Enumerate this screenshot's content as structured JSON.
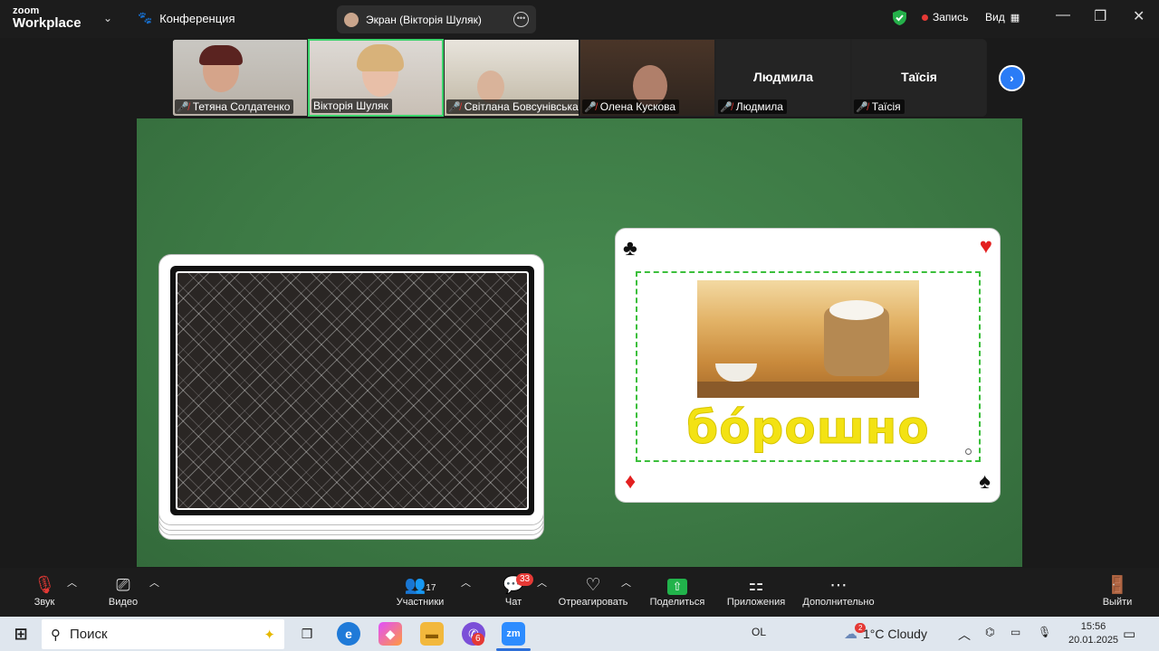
{
  "app": {
    "logo_top": "zoom",
    "logo_bottom": "Workplace",
    "meeting_label": "Конференция"
  },
  "share_pill": {
    "label": "Экран (Вікторія Шуляк)"
  },
  "header": {
    "record_label": "Запись",
    "view_label": "Вид"
  },
  "participants": [
    {
      "name": "Тетяна Солдатенко",
      "video": true,
      "muted": true
    },
    {
      "name": "Вікторія Шуляк",
      "video": true,
      "muted": false,
      "active": true
    },
    {
      "name": "Світлана Бовсунівська",
      "video": true,
      "muted": true
    },
    {
      "name": "Олена Кускова",
      "video": true,
      "muted": true
    },
    {
      "name": "Людмила",
      "display": "Людмила",
      "video": false,
      "muted": true
    },
    {
      "name": "Таїсія",
      "display": "Таїсія",
      "video": false,
      "muted": true
    }
  ],
  "card": {
    "word": "бо́рошно",
    "suits": {
      "top_left": "♣",
      "top_right": "♥",
      "bottom_left": "♦",
      "bottom_right": "♠"
    }
  },
  "toolbar": {
    "audio": "Звук",
    "video": "Видео",
    "participants": "Участники",
    "participants_count": "17",
    "chat": "Чат",
    "chat_badge": "33",
    "react": "Отреагировать",
    "share": "Поделиться",
    "apps": "Приложения",
    "more": "Дополнительно",
    "leave": "Выйти"
  },
  "taskbar": {
    "search_placeholder": "Поиск",
    "app_badge": "6",
    "lang": "OL",
    "weather": "1°C Cloudy",
    "weather_badge": "2",
    "time": "15:56",
    "date": "20.01.2025"
  },
  "colors": {
    "accent": "#2a7cf6",
    "active_border": "#3bd36b",
    "table_green": "#3d7a45",
    "word_yellow": "#f3e213"
  }
}
